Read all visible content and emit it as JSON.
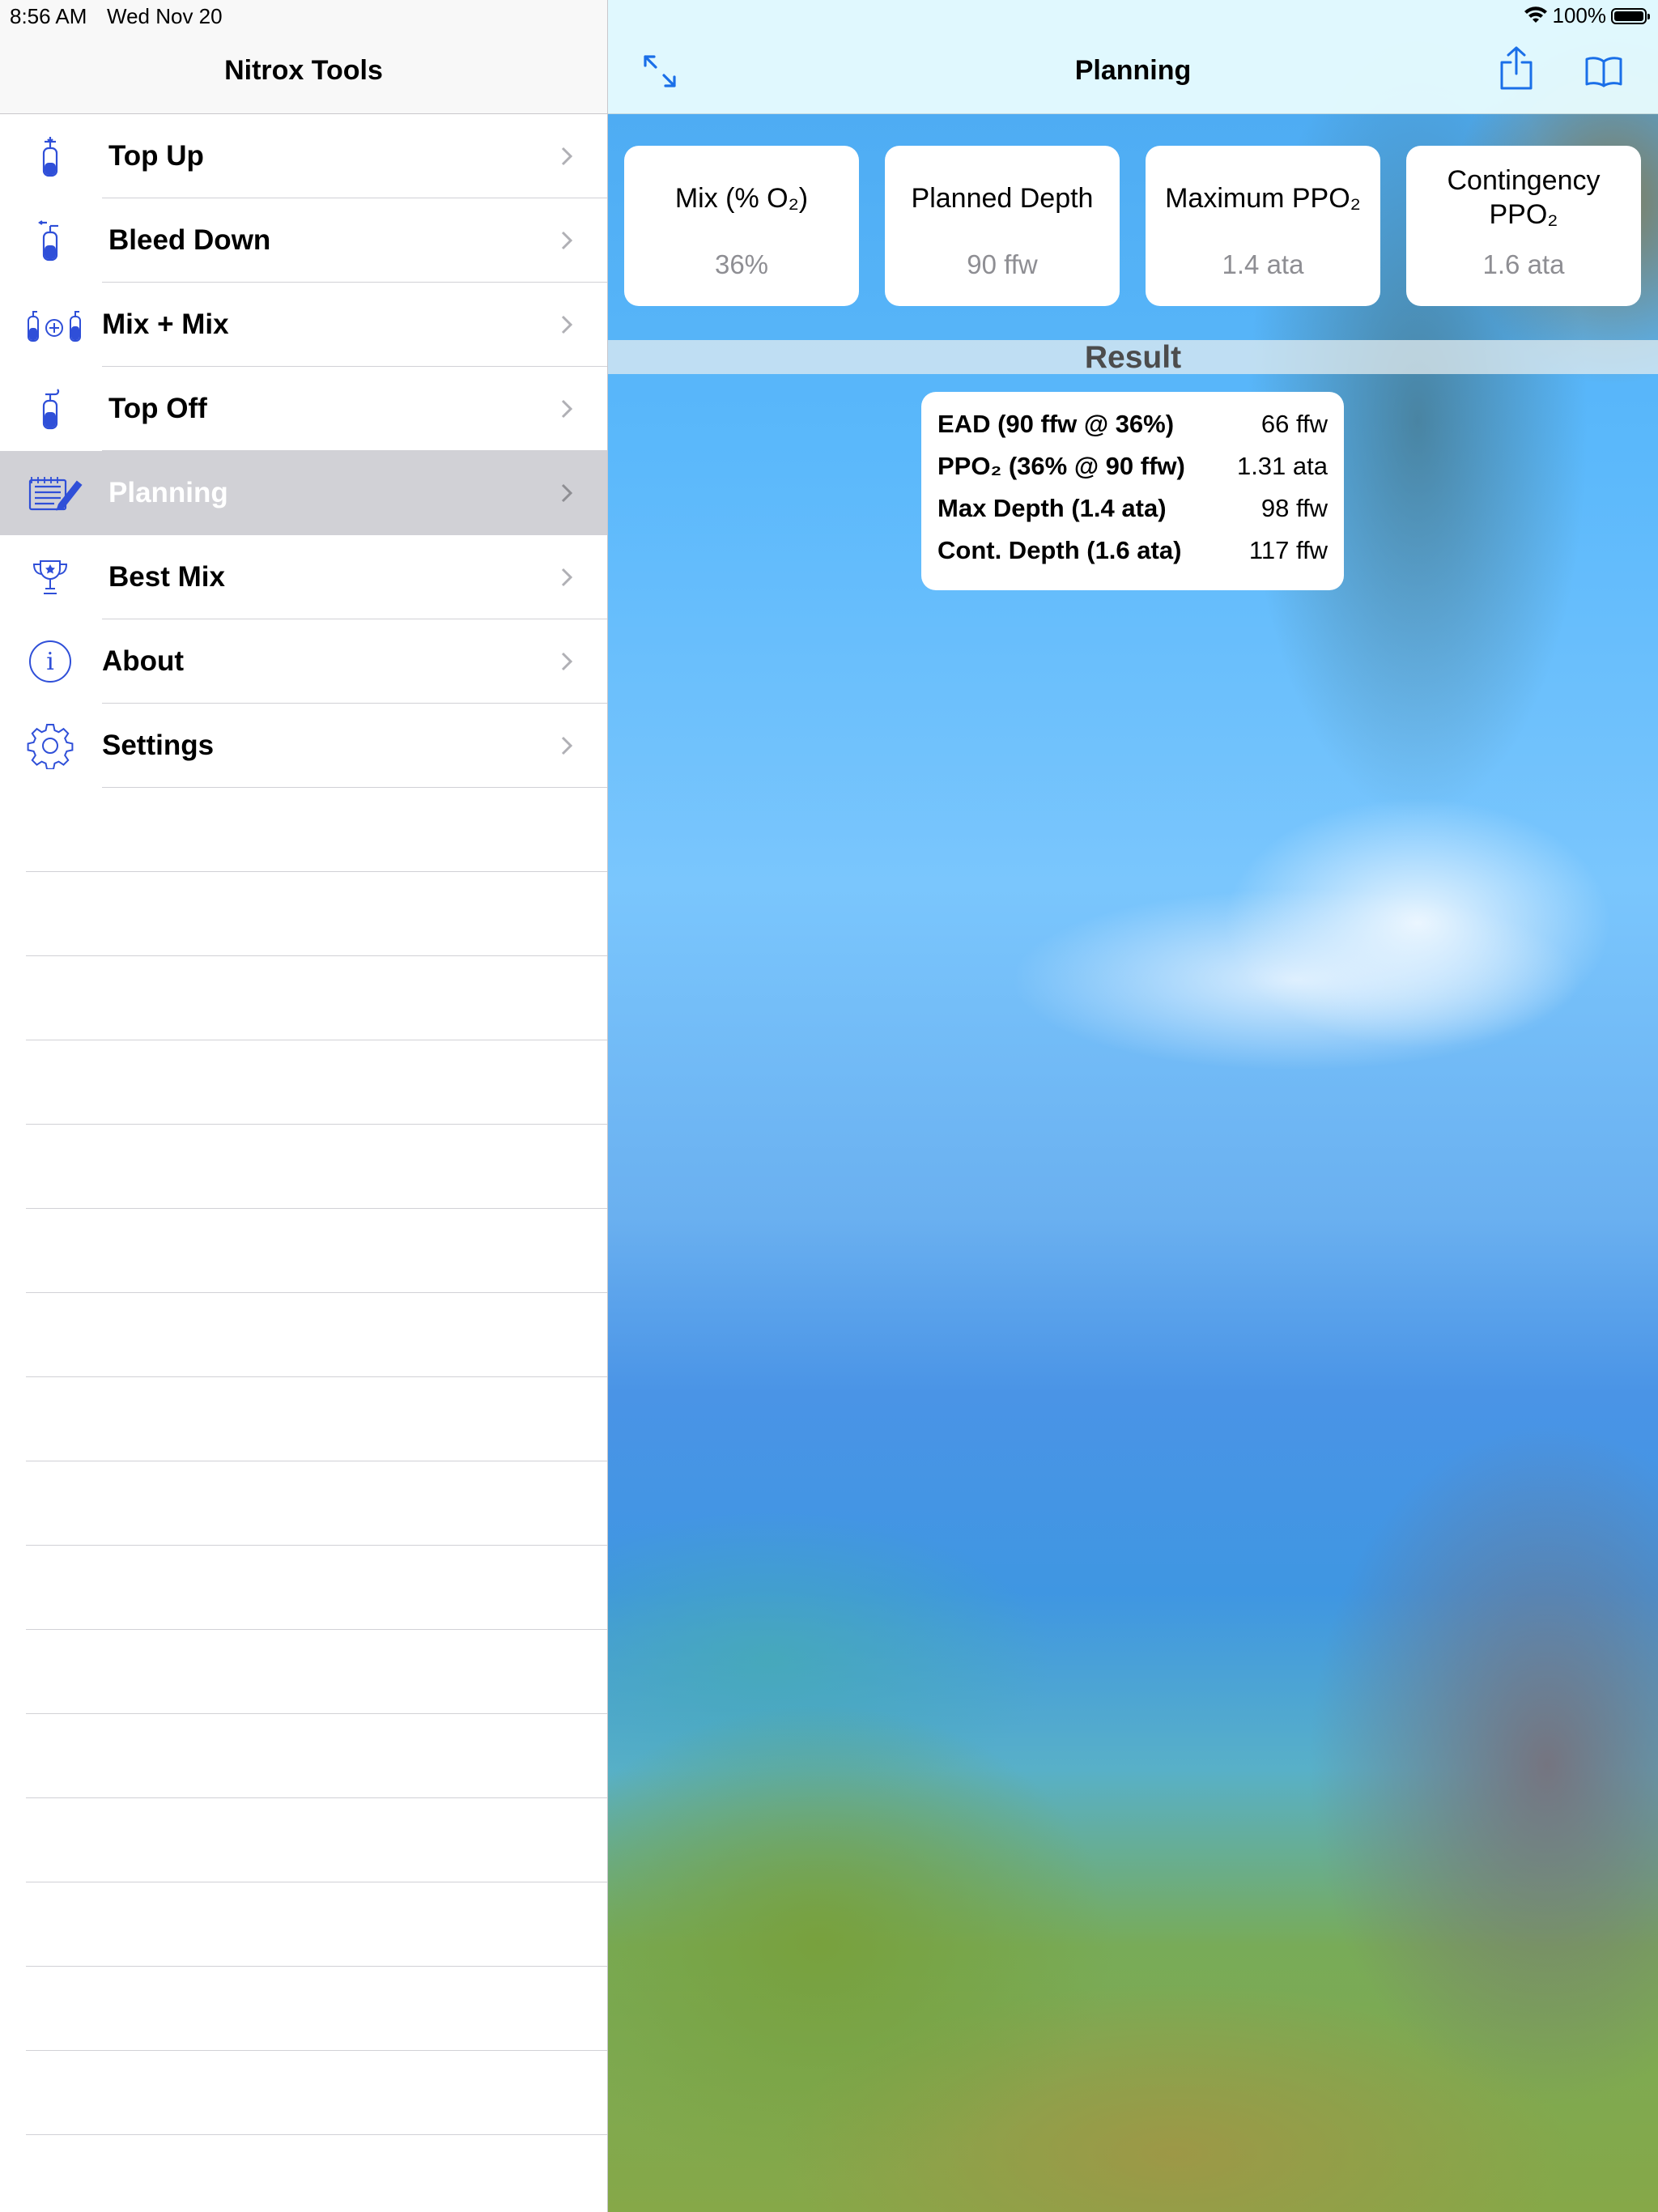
{
  "status_bar": {
    "time": "8:56 AM",
    "date": "Wed Nov 20",
    "battery": "100%"
  },
  "sidebar": {
    "title": "Nitrox Tools",
    "items": [
      {
        "label": "Top Up",
        "icon": "tank-top-up-icon",
        "selected": false
      },
      {
        "label": "Bleed Down",
        "icon": "tank-bleed-down-icon",
        "selected": false
      },
      {
        "label": "Mix + Mix",
        "icon": "tanks-mix-icon",
        "selected": false
      },
      {
        "label": "Top Off",
        "icon": "tank-top-off-icon",
        "selected": false
      },
      {
        "label": "Planning",
        "icon": "planning-notepad-icon",
        "selected": true
      },
      {
        "label": "Best Mix",
        "icon": "trophy-icon",
        "selected": false
      },
      {
        "label": "About",
        "icon": "info-icon",
        "selected": false
      },
      {
        "label": "Settings",
        "icon": "gear-icon",
        "selected": false
      }
    ]
  },
  "detail": {
    "title": "Planning",
    "inputs": [
      {
        "label_lines": [
          "Mix (% O₂)"
        ],
        "value": "36%"
      },
      {
        "label_lines": [
          "Planned Depth"
        ],
        "value": "90 ffw"
      },
      {
        "label_lines": [
          "Maximum PPO₂"
        ],
        "value": "1.4 ata"
      },
      {
        "label_lines": [
          "Contingency",
          "PPO₂"
        ],
        "value": "1.6 ata"
      }
    ],
    "result_header": "Result",
    "results": [
      {
        "label": "EAD (90 ffw @ 36%)",
        "value": "66 ffw"
      },
      {
        "label": "PPO₂ (36% @ 90 ffw)",
        "value": "1.31 ata"
      },
      {
        "label": "Max Depth (1.4 ata)",
        "value": "98 ffw"
      },
      {
        "label": "Cont. Depth (1.6 ata)",
        "value": "117 ffw"
      }
    ]
  },
  "colors": {
    "accent": "#1a6fe8",
    "icon_blue": "#2f4fd8",
    "selected_row": "#d1d1d6",
    "secondary_text": "#8e8e93"
  }
}
